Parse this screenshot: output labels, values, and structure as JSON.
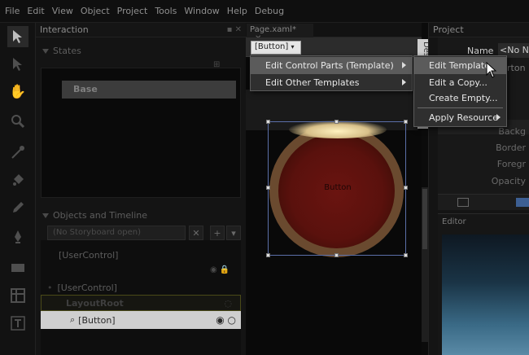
{
  "menubar": [
    "File",
    "Edit",
    "View",
    "Object",
    "Project",
    "Tools",
    "Window",
    "Help",
    "Debug"
  ],
  "panels": {
    "interaction": {
      "title": "Interaction"
    },
    "states": {
      "title": "States",
      "base": "Base"
    },
    "objects": {
      "title": "Objects and Timeline",
      "storyboard_placeholder": "(No Storyboard open)",
      "root_label": "[UserControl]",
      "tree": [
        {
          "label": "[UserControl]"
        },
        {
          "label": "LayoutRoot"
        },
        {
          "label": "[Button]"
        }
      ]
    },
    "project": {
      "title": "Project"
    }
  },
  "document": {
    "tab_label": "Page.xaml*",
    "breadcrumb": "[Button]",
    "design_tab": "Design",
    "button_text": "Button"
  },
  "context_menu": {
    "items": [
      {
        "label": "Edit Control Parts (Template)",
        "has_submenu": true,
        "highlighted": true
      },
      {
        "label": "Edit Other Templates",
        "has_submenu": true,
        "highlighted": false
      }
    ]
  },
  "submenu": {
    "items": [
      {
        "label": "Edit Template",
        "highlighted": true
      },
      {
        "label": "Edit a Copy...",
        "highlighted": false
      },
      {
        "label": "Create Empty...",
        "highlighted": false
      },
      {
        "label": "Apply Resource",
        "has_submenu": true,
        "highlighted": false
      }
    ]
  },
  "properties": {
    "name_label": "Name",
    "name_value": "<No Name>",
    "type_fragment": "rton",
    "fields": [
      "Backg",
      "Border",
      "Foregr",
      "Opacity"
    ],
    "editor_label": "Editor"
  },
  "colors": {
    "background": "#0b0b0b",
    "button_fill": "#5a110d",
    "button_rim": "#6a4a2f",
    "selection": "#5b6fa8",
    "menu_bg": "#2f2f2f",
    "menu_highlight": "#5b5b5b"
  }
}
